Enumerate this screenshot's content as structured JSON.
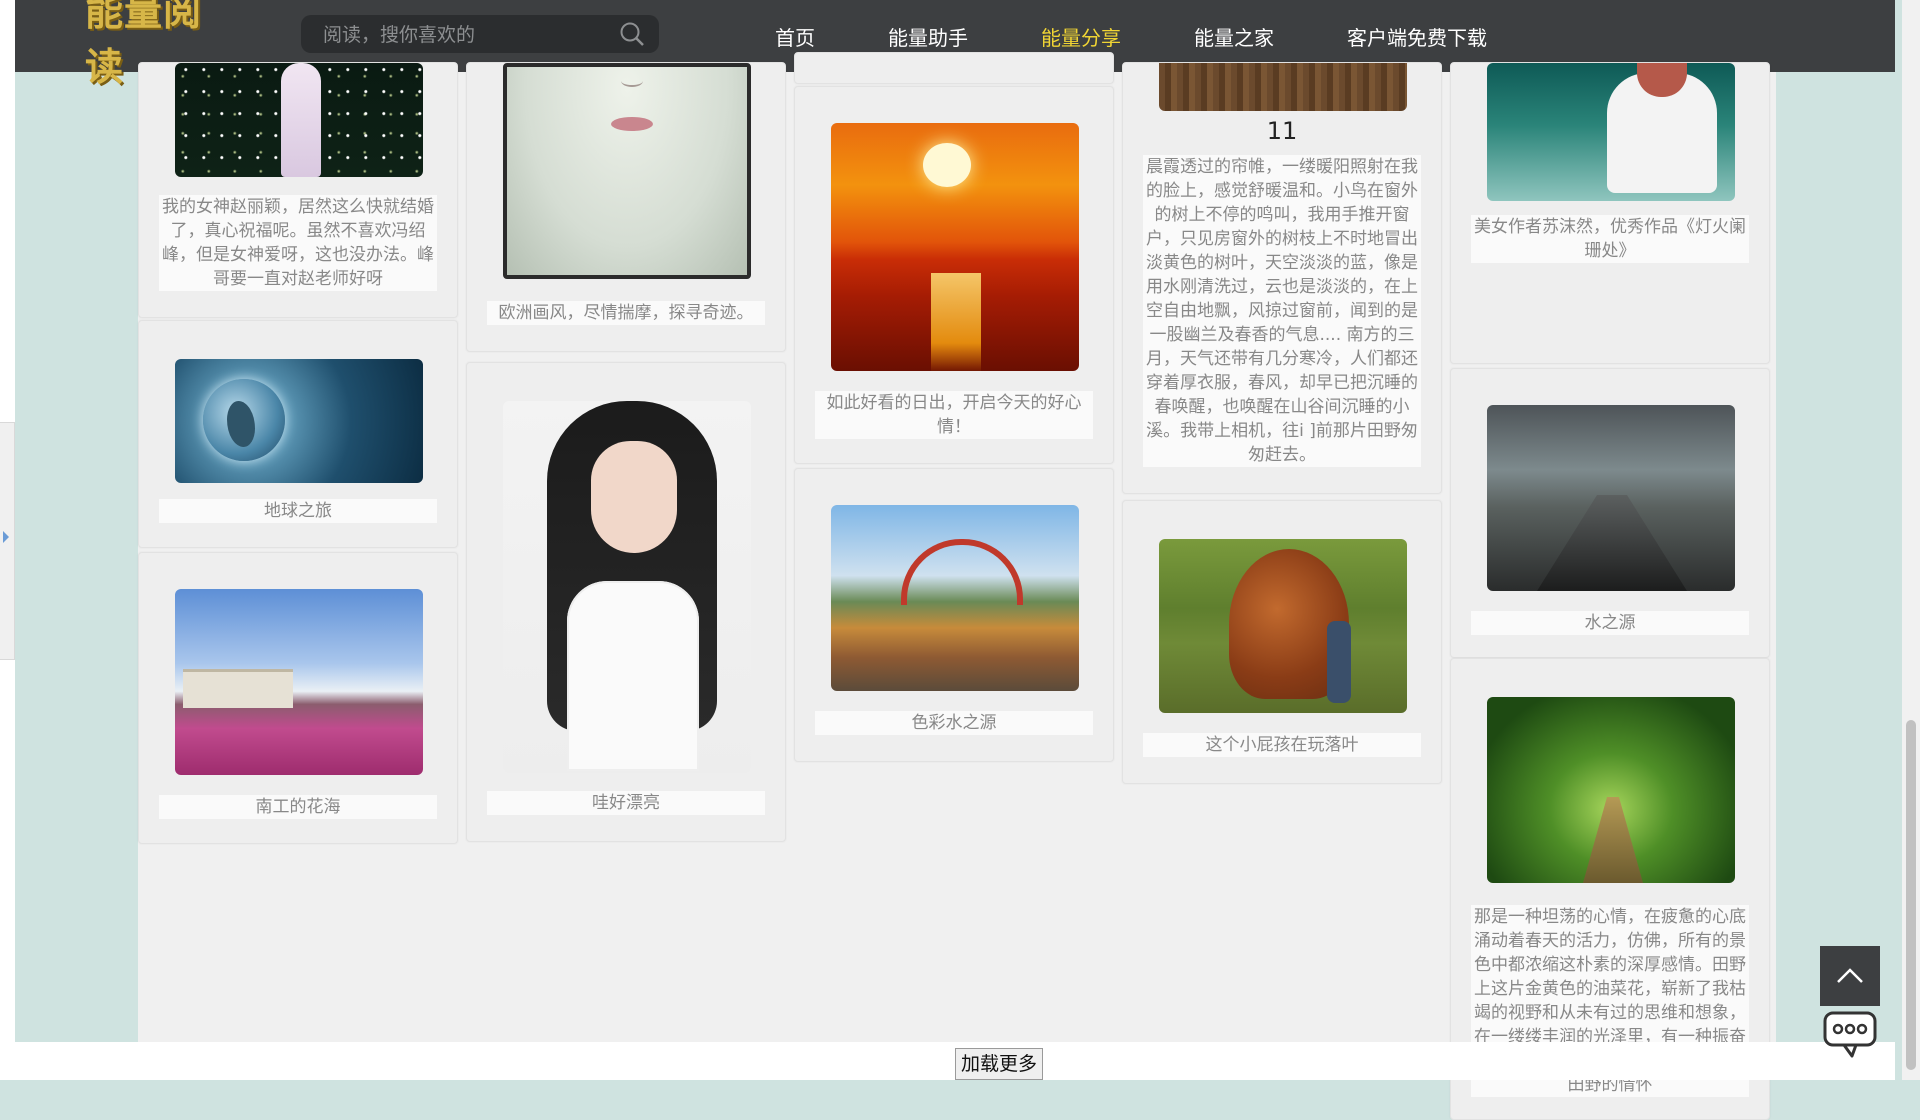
{
  "header": {
    "logo": "能量阅读",
    "search_placeholder": "阅读，搜你喜欢的",
    "nav": [
      {
        "label": "首页",
        "active": false
      },
      {
        "label": "能量助手",
        "active": false
      },
      {
        "label": "能量分享",
        "active": true
      },
      {
        "label": "能量之家",
        "active": false
      },
      {
        "label": "客户端免费下载",
        "active": false
      }
    ],
    "colors": {
      "bar": "#3d3f41",
      "active": "#f1d534",
      "logo": "#d7b648"
    }
  },
  "cards": [
    {
      "image_icon": "woman-in-white-dress-night-photo",
      "caption": "我的女神赵丽颖，居然这么快就结婚了，真心祝福呢。虽然不喜欢冯绍峰，但是女神爱呀，这也没办法。峰哥要一直对赵老师好呀"
    },
    {
      "image_icon": "globe-photo",
      "caption": "地球之旅"
    },
    {
      "image_icon": "flower-field-photo",
      "caption": "南工的花海"
    },
    {
      "image_icon": "woman-face-painting",
      "caption": "欧洲画风，尽情揣摩，探寻奇迹。"
    },
    {
      "image_icon": "young-woman-portrait",
      "caption": "哇好漂亮"
    },
    {
      "image_icon": "sunset-sea-photo",
      "caption": "如此好看的日出，开启今天的好心情！"
    },
    {
      "image_icon": "fountain-sculpture-photo",
      "caption": "色彩水之源"
    },
    {
      "image_icon": "wooden-floor-photo",
      "number": "11",
      "caption": "晨霞透过的帘帷，一缕暖阳照射在我的脸上，感觉舒暖温和。小鸟在窗外的树上不停的鸣叫，我用手推开窗户，只见房窗外的树枝上不时地冒出淡黄色的树叶，天空淡淡的蓝，像是用水刚清洗过，云也是淡淡的，在上空自由地飘，风掠过窗前，闻到的是一股幽兰及春香的气息.... 南方的三月，天气还带有几分寒冷，人们都还穿着厚衣服，春风，却早已把沉睡的春唤醒，也唤醒在山谷间沉睡的小溪。我带上相机，往i ]前那片田野匆匆赶去。"
    },
    {
      "image_icon": "child-in-leaves-photo",
      "caption": "这个小屁孩在玩落叶"
    },
    {
      "image_icon": "girl-by-lake-photo",
      "caption": "美女作者苏沫然，优秀作品《灯火阑珊处》"
    },
    {
      "image_icon": "bridge-road-photo",
      "caption": "水之源"
    },
    {
      "image_icon": "forest-path-photo",
      "caption": "那是一种坦荡的心情，在疲惫的心底涌动着春天的活力，仿佛，所有的景色中都浓缩这朴素的深厚感情。田野上这片金黄色的油菜花，崭新了我枯竭的视野和从未有过的思维和想象，在一缕缕丰润的光泽里，有一种振奋的感悟，那是自然的流光涌现着这片田野的情怀"
    }
  ],
  "footer": {
    "load_more": "加载更多"
  }
}
